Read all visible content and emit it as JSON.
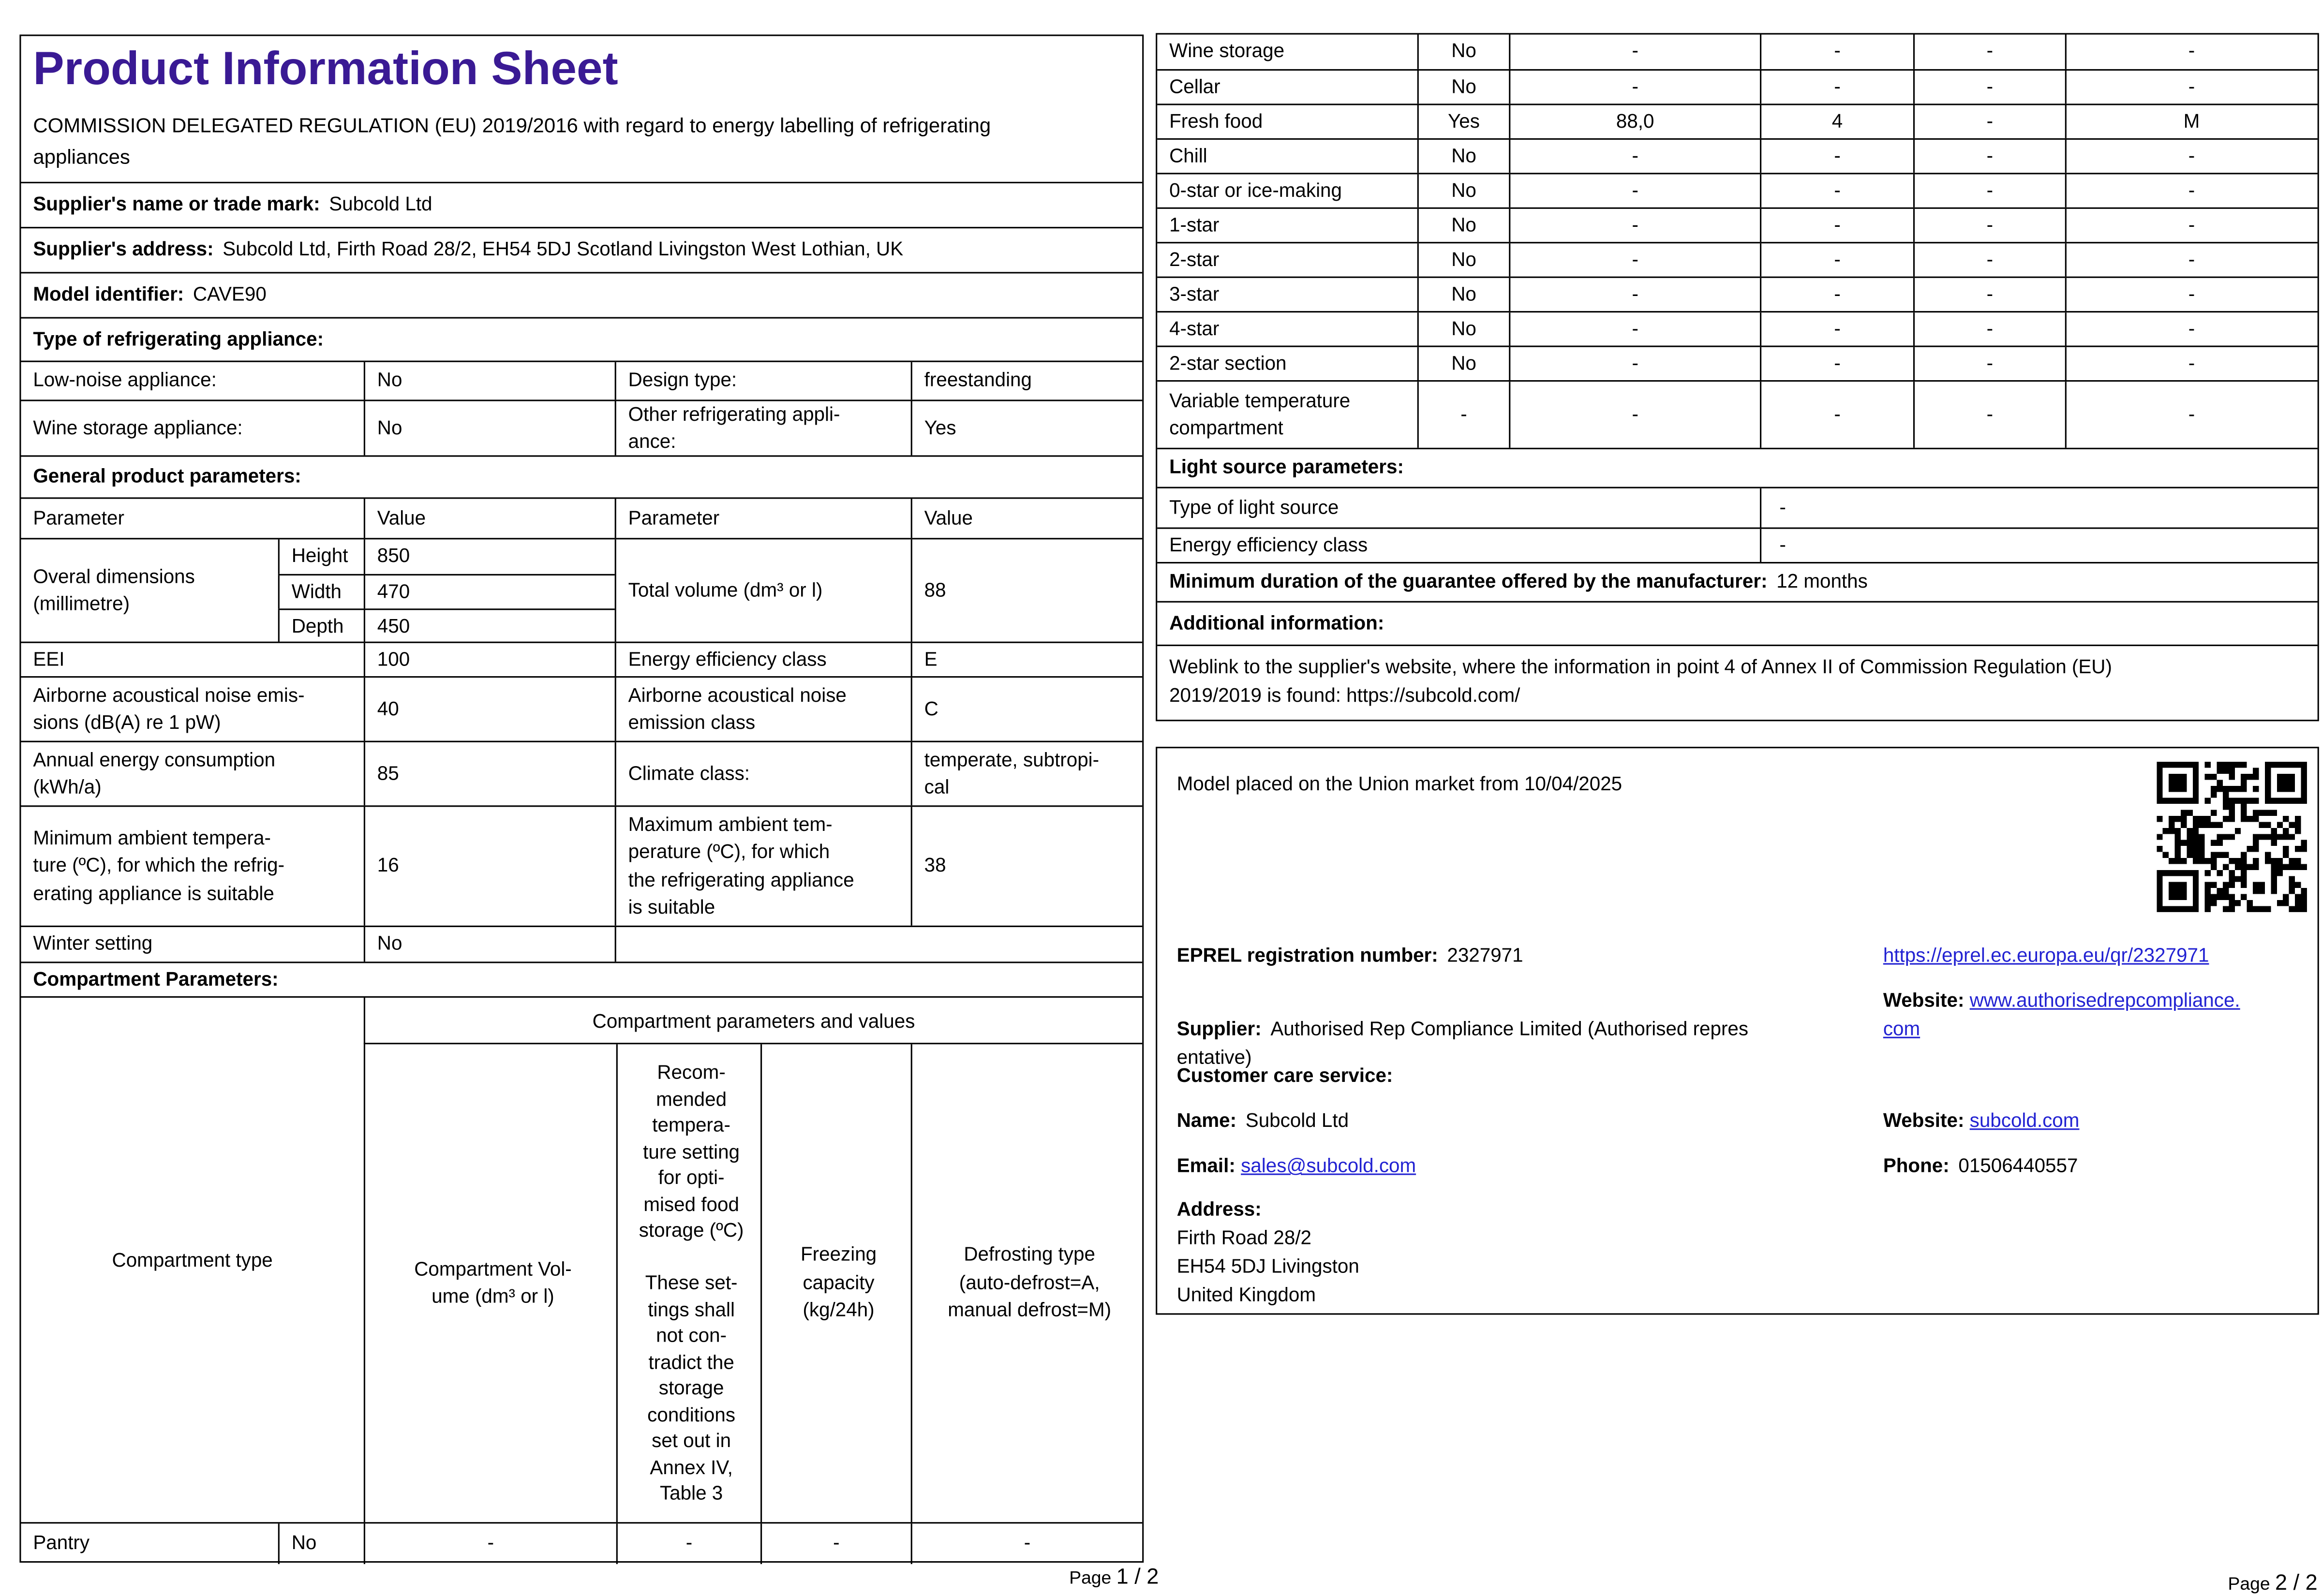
{
  "colors": {
    "accent_purple": "#3a1a94",
    "link_blue": "#2222d2",
    "border": "#000000"
  },
  "icons": {
    "qr": "qr-code"
  },
  "p1": {
    "title": "Product Information Sheet",
    "subtitle": "COMMISSION DELEGATED REGULATION (EU) 2019/2016 with regard to energy labelling of refrigerating\nappliances",
    "supplier_name": {
      "label": "Supplier's name or trade mark:",
      "value": "Subcold Ltd"
    },
    "supplier_address": {
      "label": "Supplier's address:",
      "value": "Subcold Ltd, Firth Road 28/2, EH54 5DJ Scotland Livingston West Lothian, UK"
    },
    "model_identifier": {
      "label": "Model identifier:",
      "value": "CAVE90"
    },
    "type_heading": "Type of refrigerating appliance:",
    "lownoise": {
      "c1": "Low-noise appliance:",
      "c2": "No",
      "c3": "Design type:",
      "c4": "freestanding"
    },
    "winestore": {
      "c1": "Wine storage appliance:",
      "c2": "No",
      "c3": "Other refrigerating appli-\nance:",
      "c4": "Yes"
    },
    "general_heading": "General product parameters:",
    "param_header": {
      "c1": "Parameter",
      "c2": "Value",
      "c3": "Parameter",
      "c4": "Value"
    },
    "dims": {
      "label": "Overal dimensions\n(millimetre)",
      "rows": [
        {
          "k": "Height",
          "v": "850"
        },
        {
          "k": "Width",
          "v": "470"
        },
        {
          "k": "Depth",
          "v": "450"
        }
      ],
      "right_label": "Total volume (dm³ or l)",
      "right_value": "88"
    },
    "eei": {
      "c1": "EEI",
      "c2": "100",
      "c3": "Energy efficiency class",
      "c4": "E"
    },
    "noise": {
      "c1": "Airborne acoustical noise emis-\nsions (dB(A) re 1 pW)",
      "c2": "40",
      "c3": "Airborne acoustical noise\nemission class",
      "c4": "C"
    },
    "energy": {
      "c1": "Annual energy consumption\n(kWh/a)",
      "c2": "85",
      "c3": "Climate class:",
      "c4": "temperate, subtropi-\ncal"
    },
    "ambient": {
      "c1": "Minimum ambient tempera-\nture (ºC), for which the refrig-\nerating appliance is suitable",
      "c2": "16",
      "c3": "Maximum ambient tem-\nperature (ºC), for which\nthe refrigerating appliance\nis suitable",
      "c4": "38"
    },
    "winter": {
      "c1": "Winter setting",
      "c2": "No"
    },
    "compartment_heading": "Compartment Parameters:",
    "comp_header": {
      "merged": "Compartment type",
      "top": "Compartment parameters and values",
      "volume": "Compartment Vol-\nume (dm³ or l)",
      "temp": "Recom-\nmended\ntempera-\nture setting\nfor opti-\nmised food\nstorage (ºC)\n\nThese set-\ntings shall\nnot con-\ntradict the\nstorage\nconditions\nset out in\nAnnex IV,\nTable 3",
      "freezing": "Freezing\ncapacity\n(kg/24h)",
      "defrost": "Defrosting type\n(auto-defrost=A,\nmanual defrost=M)"
    },
    "pantry": {
      "t": "Pantry",
      "p": "No",
      "v": "-",
      "r": "-",
      "f": "-",
      "d": "-"
    },
    "footer": {
      "prefix": "Page",
      "nums": "1 / 2"
    }
  },
  "p2": {
    "rows": [
      {
        "t": "Wine storage",
        "p": "No",
        "v": "-",
        "r": "-",
        "f": "-",
        "d": "-"
      },
      {
        "t": "Cellar",
        "p": "No",
        "v": "-",
        "r": "-",
        "f": "-",
        "d": "-"
      },
      {
        "t": "Fresh food",
        "p": "Yes",
        "v": "88,0",
        "r": "4",
        "f": "-",
        "d": "M"
      },
      {
        "t": "Chill",
        "p": "No",
        "v": "-",
        "r": "-",
        "f": "-",
        "d": "-"
      },
      {
        "t": "0-star or ice-making",
        "p": "No",
        "v": "-",
        "r": "-",
        "f": "-",
        "d": "-"
      },
      {
        "t": "1-star",
        "p": "No",
        "v": "-",
        "r": "-",
        "f": "-",
        "d": "-"
      },
      {
        "t": "2-star",
        "p": "No",
        "v": "-",
        "r": "-",
        "f": "-",
        "d": "-"
      },
      {
        "t": "3-star",
        "p": "No",
        "v": "-",
        "r": "-",
        "f": "-",
        "d": "-"
      },
      {
        "t": "4-star",
        "p": "No",
        "v": "-",
        "r": "-",
        "f": "-",
        "d": "-"
      },
      {
        "t": "2-star section",
        "p": "No",
        "v": "-",
        "r": "-",
        "f": "-",
        "d": "-"
      },
      {
        "t": "Variable temperature\ncompartment",
        "p": "-",
        "v": "-",
        "r": "-",
        "f": "-",
        "d": "-"
      }
    ],
    "light_heading": "Light source parameters:",
    "light_rows": [
      {
        "label": "Type of light source",
        "value": "-"
      },
      {
        "label": "Energy efficiency class",
        "value": "-"
      }
    ],
    "guarantee": {
      "label": "Minimum duration of the guarantee offered by the manufacturer:",
      "value": "12 months"
    },
    "additional_heading": "Additional information:",
    "weblink_text": "Weblink to the supplier's website, where the information in point 4 of Annex II of Commission Regulation (EU)\n2019/2019 is found:  https://subcold.com/",
    "box": {
      "model_line": "Model placed on the Union market from 10/04/2025",
      "eprel_label": "EPREL registration number:",
      "eprel_value": "2327971",
      "eprel_link": "https://eprel.ec.europa.eu/qr/2327971",
      "supplier_label": "Supplier:",
      "supplier_value": "Authorised Rep Compliance Limited (Authorised repres\nentative)",
      "website_label": "Website:",
      "website_link": "www.authorisedrepcompliance.\ncom",
      "care_heading": "Customer care service:",
      "name_label": "Name:",
      "name_value": "Subcold Ltd",
      "website2_label": "Website:",
      "website2_link": "subcold.com",
      "email_label": "Email:",
      "email_link": "sales@subcold.com",
      "phone_label": "Phone:",
      "phone_value": "01506440557",
      "address_label": "Address:",
      "address_lines": "Firth Road 28/2\n EH54 5DJ Livingston\nUnited Kingdom"
    },
    "footer": {
      "prefix": "Page",
      "nums": "2 / 2"
    }
  }
}
